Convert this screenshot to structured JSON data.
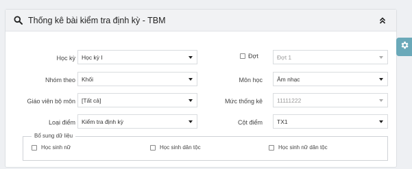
{
  "panel": {
    "title": "Thống kê bài kiểm tra định kỳ - TBM"
  },
  "fields": {
    "hoc_ky": {
      "label": "Học kỳ",
      "value": "Học kỳ I"
    },
    "dot": {
      "label": "Đợt",
      "value": "Đợt 1",
      "checked": false
    },
    "nhom_theo": {
      "label": "Nhóm theo",
      "value": "Khối"
    },
    "mon_hoc": {
      "label": "Môn học",
      "value": "Âm nhạc"
    },
    "giao_vien": {
      "label": "Giáo viên bộ môn",
      "value": "[Tất cả]"
    },
    "muc_thong_ke": {
      "label": "Mức thống kê",
      "value": "11111222"
    },
    "loai_diem": {
      "label": "Loại điểm",
      "value": "Kiểm tra định kỳ"
    },
    "cot_diem": {
      "label": "Cột điểm",
      "value": "TX1"
    }
  },
  "supplement": {
    "legend": "Bổ sung dữ liệu",
    "options": [
      {
        "label": "Học sinh nữ",
        "checked": false
      },
      {
        "label": "Học sinh dân tộc",
        "checked": false
      },
      {
        "label": "Học sinh nữ dân tộc",
        "checked": false
      }
    ]
  },
  "icons": {
    "header": "search-icon",
    "collapse": "double-chevron-up-icon",
    "side": "gear-icon"
  },
  "colors": {
    "side_button": "#6aa9b9",
    "header_bg": "#f1f2f4"
  }
}
